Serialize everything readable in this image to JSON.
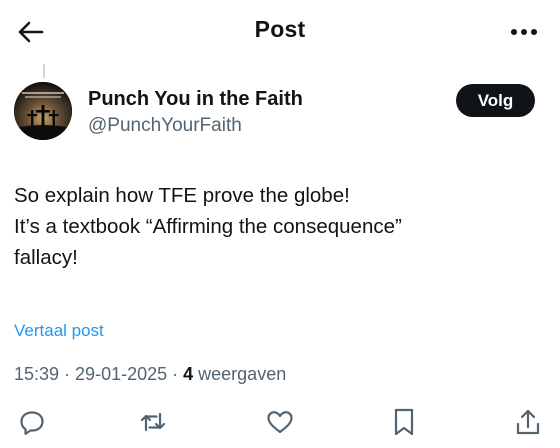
{
  "header": {
    "title": "Post",
    "back_icon": "arrow-left-icon",
    "more_icon": "more-horizontal-icon"
  },
  "author": {
    "name": "Punch You in the Faith",
    "handle": "@PunchYourFaith",
    "avatar_icon": "crosses-avatar-image"
  },
  "follow": {
    "label": "Volg"
  },
  "post": {
    "lines": [
      "So explain how TFE prove the globe!",
      "It’s a textbook “Affirming the consequence”",
      "fallacy!"
    ]
  },
  "translate_label": "Vertaal post",
  "meta": {
    "time": "15:39",
    "date": "29-01-2025",
    "separator": " · ",
    "views": "4",
    "views_label": "weergaven"
  },
  "actions": {
    "icons": [
      "reply-icon",
      "repost-icon",
      "like-icon",
      "bookmark-icon",
      "share-icon"
    ]
  },
  "colors": {
    "text": "#0f1419",
    "secondary": "#536471",
    "link": "#1d9bf0",
    "follow_bg": "#0f1419"
  }
}
